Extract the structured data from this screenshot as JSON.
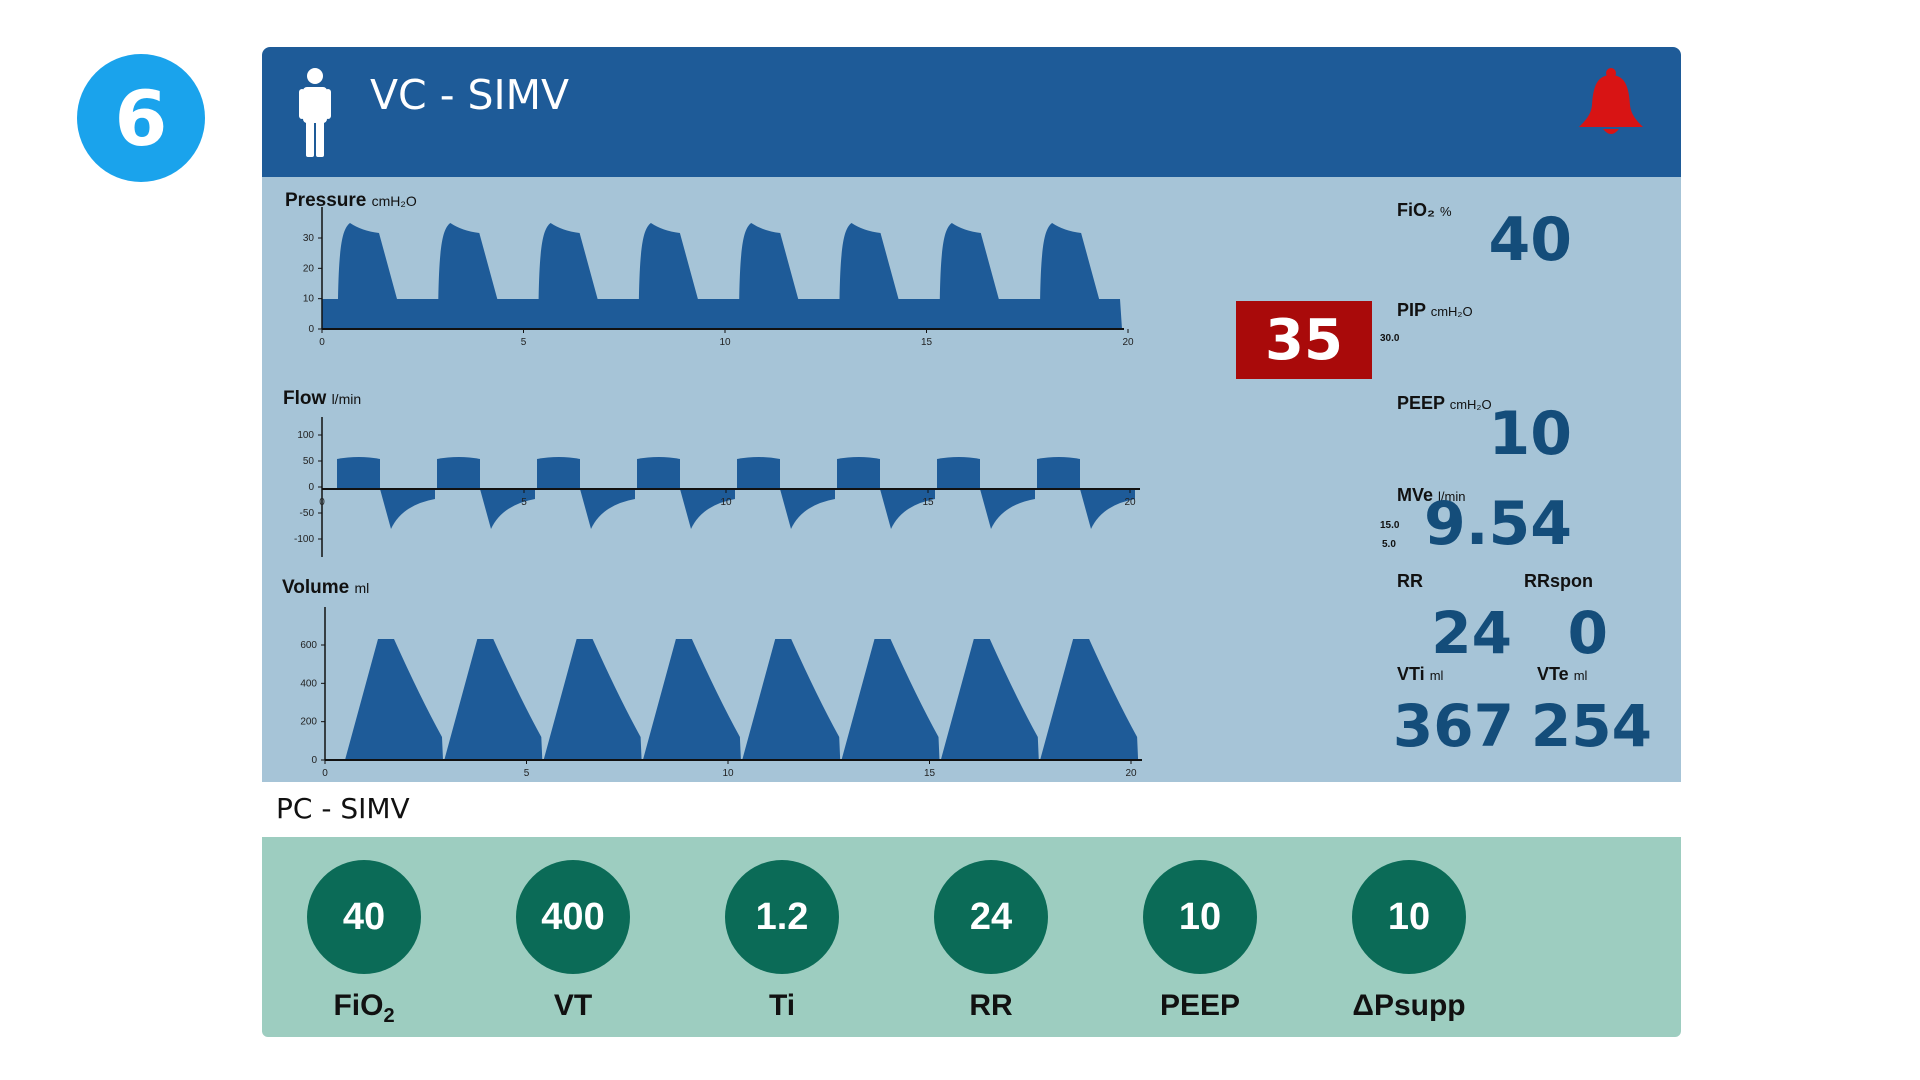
{
  "step_number": "6",
  "monitor": {
    "mode": "VC - SIMV",
    "icons": {
      "patient": "person-icon",
      "alarm": "bell-icon"
    },
    "colors": {
      "header": "#1e5b98",
      "screen": "#a6c4d7",
      "waveform": "#1e5b98",
      "alarm": "#a90a0a",
      "bell": "#d81414"
    }
  },
  "waveforms": {
    "pressure": {
      "label": "Pressure",
      "unit": "cmH₂O",
      "y_ticks": [
        "30",
        "20",
        "10",
        "0"
      ],
      "x_ticks": [
        "0",
        "5",
        "10",
        "15",
        "20"
      ]
    },
    "flow": {
      "label": "Flow",
      "unit": "l/min",
      "y_ticks": [
        "100",
        "50",
        "0",
        "-50",
        "-100"
      ],
      "x_ticks": [
        "0",
        "5",
        "10",
        "15",
        "20"
      ]
    },
    "volume": {
      "label": "Volume",
      "unit": "ml",
      "y_ticks": [
        "600",
        "400",
        "200",
        "0"
      ],
      "x_ticks": [
        "0",
        "5",
        "10",
        "15",
        "20"
      ]
    }
  },
  "parameters": {
    "fio2": {
      "label": "FiO₂",
      "unit": "%",
      "value": "40"
    },
    "pip": {
      "label": "PIP",
      "unit": "cmH₂O",
      "value": "35",
      "limit": "30.0"
    },
    "peep": {
      "label": "PEEP",
      "unit": "cmH₂O",
      "value": "10"
    },
    "mve": {
      "label": "MVe",
      "unit": "l/min",
      "value": "9.54",
      "limit_high": "15.0",
      "limit_low": "5.0"
    },
    "rr": {
      "label": "RR",
      "value": "24"
    },
    "rrspon": {
      "label": "RRspon",
      "value": "0"
    },
    "vti": {
      "label": "VTi",
      "unit": "ml",
      "value": "367"
    },
    "vte": {
      "label": "VTe",
      "unit": "ml",
      "value": "254"
    }
  },
  "settings": {
    "mode": "PC - SIMV",
    "knobs": [
      {
        "value": "40",
        "label": "FiO",
        "label_sub": "2"
      },
      {
        "value": "400",
        "label": "VT"
      },
      {
        "value": "1.2",
        "label": "Ti"
      },
      {
        "value": "24",
        "label": "RR"
      },
      {
        "value": "10",
        "label": "PEEP"
      },
      {
        "value": "10",
        "label": "ΔPsupp"
      }
    ],
    "colors": {
      "panel": "#9dcdc0",
      "knob": "#0b6b57"
    }
  }
}
